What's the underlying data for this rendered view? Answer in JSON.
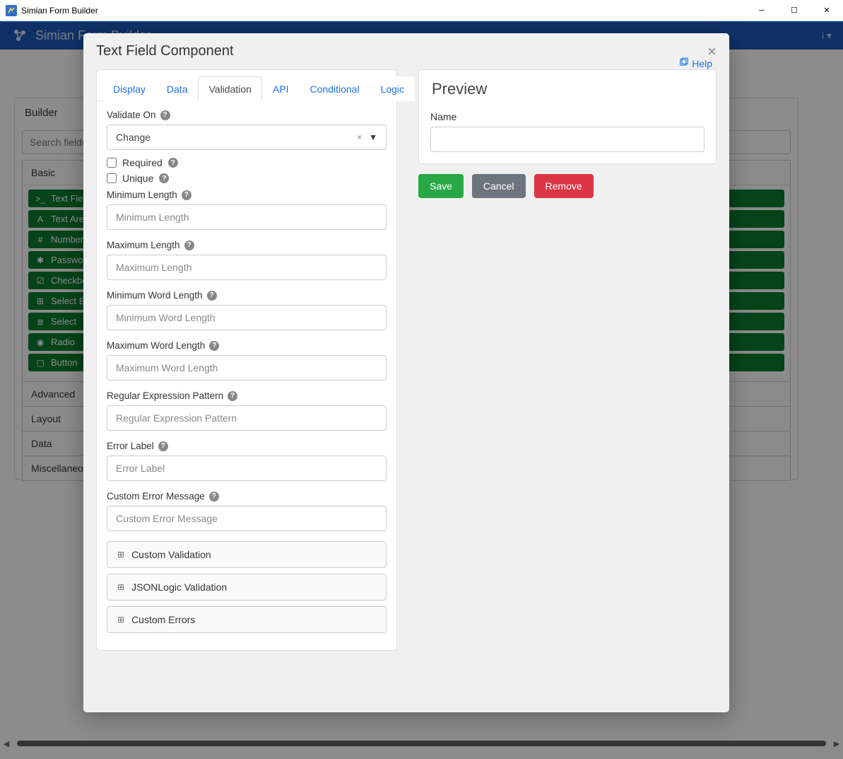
{
  "window": {
    "title": "Simian Form Builder"
  },
  "header": {
    "app_title": "Simian Form Builder"
  },
  "builder": {
    "title": "Builder",
    "search_placeholder": "Search field(s)",
    "groups": [
      {
        "label": "Basic",
        "open": true,
        "items": [
          {
            "label": "Text Field",
            "icon": "terminal"
          },
          {
            "label": "Text Area",
            "icon": "font"
          },
          {
            "label": "Number",
            "icon": "hash"
          },
          {
            "label": "Password",
            "icon": "asterisk"
          },
          {
            "label": "Checkbox",
            "icon": "check-square"
          },
          {
            "label": "Select Boxes",
            "icon": "plus-square"
          },
          {
            "label": "Select",
            "icon": "list"
          },
          {
            "label": "Radio",
            "icon": "dot-circle"
          },
          {
            "label": "Button",
            "icon": "square-outline"
          }
        ]
      },
      {
        "label": "Advanced",
        "open": false
      },
      {
        "label": "Layout",
        "open": false
      },
      {
        "label": "Data",
        "open": false
      },
      {
        "label": "Miscellaneous",
        "open": false
      }
    ]
  },
  "modal": {
    "title": "Text Field Component",
    "help_label": "Help",
    "tabs": [
      "Display",
      "Data",
      "Validation",
      "API",
      "Conditional",
      "Logic"
    ],
    "active_tab": "Validation",
    "validation": {
      "validate_on_label": "Validate On",
      "validate_on_value": "Change",
      "required_label": "Required",
      "required_checked": false,
      "unique_label": "Unique",
      "unique_checked": false,
      "min_length_label": "Minimum Length",
      "min_length_placeholder": "Minimum Length",
      "max_length_label": "Maximum Length",
      "max_length_placeholder": "Maximum Length",
      "min_word_label": "Minimum Word Length",
      "min_word_placeholder": "Minimum Word Length",
      "max_word_label": "Maximum Word Length",
      "max_word_placeholder": "Maximum Word Length",
      "regex_label": "Regular Expression Pattern",
      "regex_placeholder": "Regular Expression Pattern",
      "error_label_label": "Error Label",
      "error_label_placeholder": "Error Label",
      "custom_error_label": "Custom Error Message",
      "custom_error_placeholder": "Custom Error Message",
      "collapsers": [
        "Custom Validation",
        "JSONLogic Validation",
        "Custom Errors"
      ]
    },
    "preview": {
      "title": "Preview",
      "field_label": "Name"
    },
    "buttons": {
      "save": "Save",
      "cancel": "Cancel",
      "remove": "Remove"
    }
  }
}
